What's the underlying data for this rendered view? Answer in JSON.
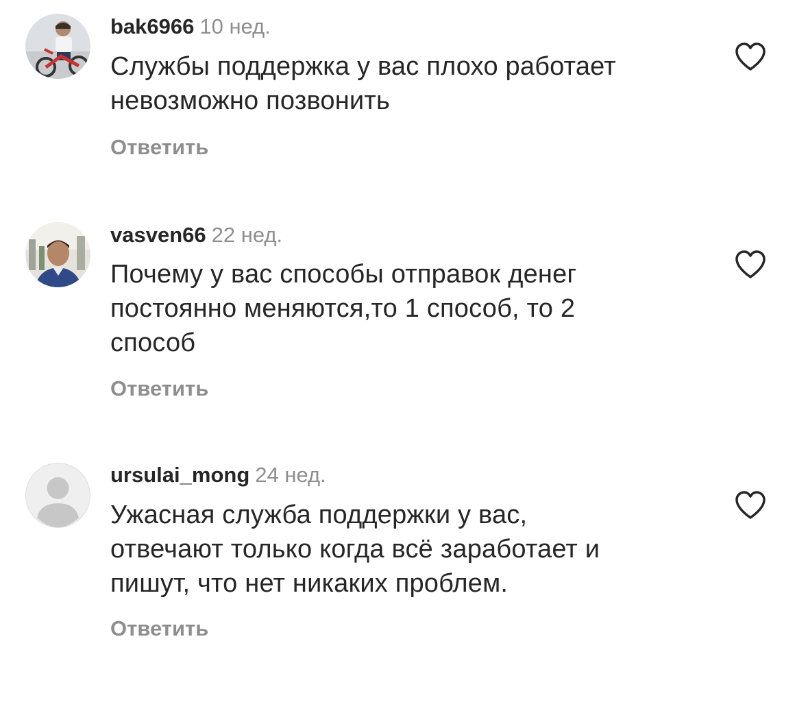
{
  "comments": [
    {
      "username": "bak6966",
      "time": "10 нед.",
      "lines": [
        "Службы  поддержка у вас плохо работает",
        "невозможно  позвонить"
      ],
      "reply_label": "Ответить",
      "avatar": "photo-child-on-bike"
    },
    {
      "username": "vasven66",
      "time": "22 нед.",
      "lines": [
        "Почему у вас способы отправок денег",
        "постоянно меняются,то 1 способ, то 2",
        "способ"
      ],
      "reply_label": "Ответить",
      "avatar": "photo-man"
    },
    {
      "username": "ursulai_mong",
      "time": "24 нед.",
      "lines": [
        "Ужасная служба поддержки у вас,",
        "отвечают только когда всё заработает и",
        "пишут, что нет никаких проблем."
      ],
      "reply_label": "Ответить",
      "avatar": "default-avatar"
    }
  ],
  "icons": {
    "like": "heart-outline-icon"
  },
  "colors": {
    "text": "#262626",
    "secondary": "#8e8e8e",
    "background": "#ffffff"
  }
}
